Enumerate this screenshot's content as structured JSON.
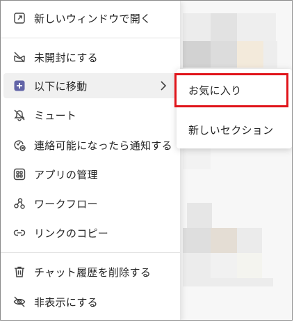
{
  "menu": {
    "items": [
      {
        "label": "新しいウィンドウで開く",
        "icon": "open-in-window-icon"
      },
      {
        "label": "未開封にする",
        "icon": "mark-unread-icon"
      },
      {
        "label": "以下に移動",
        "icon": "move-to-icon"
      },
      {
        "label": "ミュート",
        "icon": "mute-icon"
      },
      {
        "label": "連絡可能になったら通知する",
        "icon": "notify-available-icon"
      },
      {
        "label": "アプリの管理",
        "icon": "manage-apps-icon"
      },
      {
        "label": "ワークフロー",
        "icon": "workflow-icon"
      },
      {
        "label": "リンクのコピー",
        "icon": "copy-link-icon"
      },
      {
        "label": "チャット履歴を削除する",
        "icon": "delete-icon"
      },
      {
        "label": "非表示にする",
        "icon": "hide-icon"
      }
    ],
    "submenu_indicator": "chevron-right-icon"
  },
  "submenu": {
    "items": [
      {
        "label": "お気に入り"
      },
      {
        "label": "新しいセクション"
      }
    ]
  },
  "colors": {
    "accent_purple": "#6264a7",
    "highlight_red": "#e0141a",
    "hover_bg": "#f0f0f0",
    "text": "#242424"
  }
}
